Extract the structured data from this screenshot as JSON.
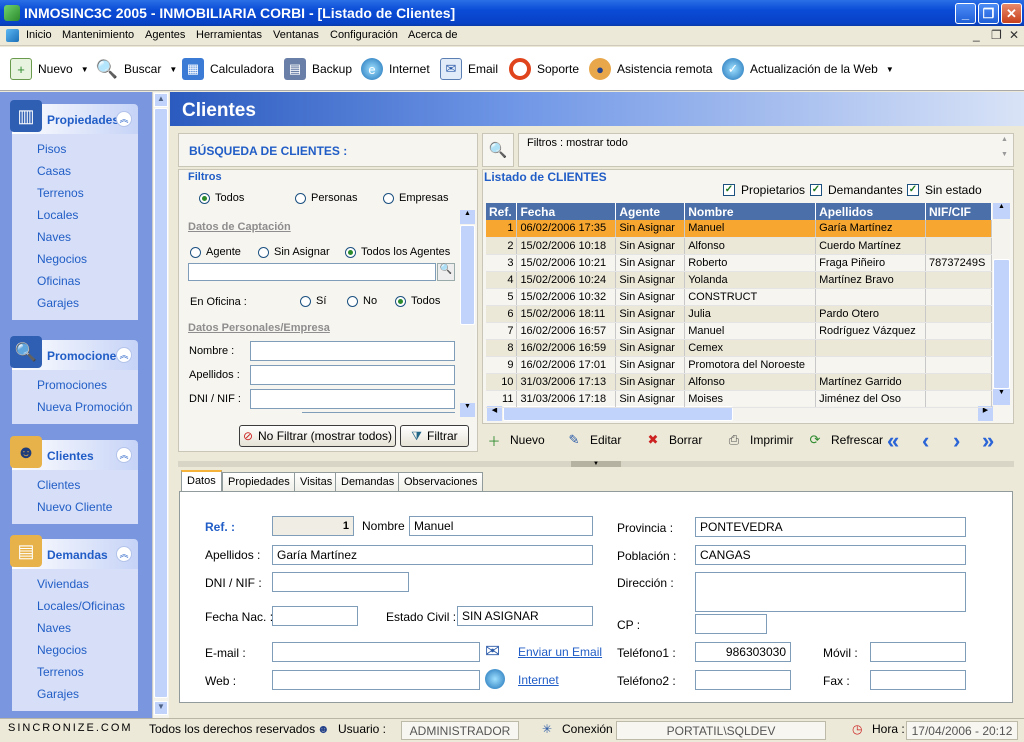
{
  "window": {
    "title": "INMOSINC3C 2005   -   INMOBILIARIA CORBI - [Listado de Clientes]"
  },
  "menu": [
    "Inicio",
    "Mantenimiento",
    "Agentes",
    "Herramientas",
    "Ventanas",
    "Configuración",
    "Acerca de"
  ],
  "toolbar": {
    "nuevo": "Nuevo",
    "buscar": "Buscar",
    "calculadora": "Calculadora",
    "backup": "Backup",
    "internet": "Internet",
    "email": "Email",
    "soporte": "Soporte",
    "asistencia": "Asistencia remota",
    "actualizacion": "Actualización de la Web"
  },
  "sidebar": {
    "propiedades": {
      "title": "Propiedades",
      "items": [
        "Pisos",
        "Casas",
        "Terrenos",
        "Locales",
        "Naves",
        "Negocios",
        "Oficinas",
        "Garajes"
      ]
    },
    "promocione": {
      "title": "Promocione",
      "items": [
        "Promociones",
        "Nueva Promoción"
      ]
    },
    "clientes": {
      "title": "Clientes",
      "items": [
        "Clientes",
        "Nuevo Cliente"
      ]
    },
    "demandas": {
      "title": "Demandas",
      "items": [
        "Viviendas",
        "Locales/Oficinas",
        "Naves",
        "Negocios",
        "Terrenos",
        "Garajes"
      ]
    }
  },
  "page": {
    "title": "Clientes"
  },
  "search": {
    "title": "BÚSQUEDA DE CLIENTES :",
    "filtros": "Filtros",
    "todos": "Todos",
    "personas": "Personas",
    "empresas": "Empresas",
    "captacion": "Datos de Captación",
    "agente": "Agente",
    "sin_asignar": "Sin Asignar",
    "todos_agentes": "Todos los Agentes",
    "en_oficina": "En Oficina :",
    "si": "Sí",
    "no": "No",
    "todos2": "Todos",
    "personales": "Datos Personales/Empresa",
    "nombre": "Nombre :",
    "apellidos": "Apellidos :",
    "dni": "DNI / NIF :",
    "no_filtrar": "No Filtrar (mostrar todos)",
    "filtrar": "Filtrar"
  },
  "filter_status": "Filtros : mostrar todo",
  "list": {
    "title": "Listado de CLIENTES",
    "checks": [
      "Propietarios",
      "Demandantes",
      "Sin estado"
    ],
    "columns": [
      "Ref.",
      "Fecha",
      "Agente",
      "Nombre",
      "Apellidos",
      "NIF/CIF"
    ],
    "rows": [
      [
        "1",
        "06/02/2006 17:35",
        "Sin Asignar",
        "Manuel",
        "Garía Martínez",
        ""
      ],
      [
        "2",
        "15/02/2006 10:18",
        "Sin Asignar",
        "Alfonso",
        "Cuerdo Martínez",
        ""
      ],
      [
        "3",
        "15/02/2006 10:21",
        "Sin Asignar",
        "Roberto",
        "Fraga Piñeiro",
        "78737249S"
      ],
      [
        "4",
        "15/02/2006 10:24",
        "Sin Asignar",
        "Yolanda",
        "Martínez Bravo",
        ""
      ],
      [
        "5",
        "15/02/2006 10:32",
        "Sin Asignar",
        "CONSTRUCT",
        "",
        ""
      ],
      [
        "6",
        "15/02/2006 18:11",
        "Sin Asignar",
        "Julia",
        "Pardo Otero",
        ""
      ],
      [
        "7",
        "16/02/2006 16:57",
        "Sin Asignar",
        "Manuel",
        "Rodríguez Vázquez",
        ""
      ],
      [
        "8",
        "16/02/2006 16:59",
        "Sin Asignar",
        "Cemex",
        "",
        ""
      ],
      [
        "9",
        "16/02/2006 17:01",
        "Sin Asignar",
        "Promotora del Noroeste",
        "",
        ""
      ],
      [
        "10",
        "31/03/2006 17:13",
        "Sin Asignar",
        "Alfonso",
        "Martínez Garrido",
        ""
      ],
      [
        "11",
        "31/03/2006 17:18",
        "Sin Asignar",
        "Moises",
        "Jiménez del Oso",
        ""
      ]
    ],
    "actions": {
      "nuevo": "Nuevo",
      "editar": "Editar",
      "borrar": "Borrar",
      "imprimir": "Imprimir",
      "refrescar": "Refrescar"
    }
  },
  "tabs": [
    "Datos",
    "Propiedades",
    "Visitas",
    "Demandas",
    "Observaciones"
  ],
  "detail": {
    "ref_label": "Ref. :",
    "ref": "1",
    "nombre_label": "Nombre :",
    "nombre": "Manuel",
    "apellidos_label": "Apellidos :",
    "apellidos": "Garía Martínez",
    "dni_label": "DNI / NIF :",
    "dni": "",
    "fecha_label": "Fecha Nac. :",
    "fecha": "",
    "estado_label": "Estado Civil :",
    "estado": "SIN ASIGNAR",
    "email_label": "E-mail :",
    "email": "",
    "enviar": "Enviar un Email",
    "web_label": "Web :",
    "web": "",
    "internet": "Internet",
    "provincia_label": "Provincia :",
    "provincia": "PONTEVEDRA",
    "poblacion_label": "Población :",
    "poblacion": "CANGAS",
    "direccion_label": "Dirección :",
    "direccion": "",
    "cp_label": "CP :",
    "cp": "",
    "tel1_label": "Teléfono1 :",
    "tel1": "986303030",
    "tel2_label": "Teléfono2 :",
    "tel2": "",
    "movil_label": "Móvil :",
    "movil": "",
    "fax_label": "Fax :",
    "fax": ""
  },
  "status": {
    "brand": "SINCRONIZE.COM",
    "rights": "Todos los derechos reservados",
    "usuario_label": "Usuario :",
    "usuario": "ADMINISTRADOR",
    "conexion_label": "Conexión :",
    "conexion": "PORTATIL\\SQLDEV",
    "hora_label": "Hora :",
    "hora": "17/04/2006 - 20:12"
  }
}
